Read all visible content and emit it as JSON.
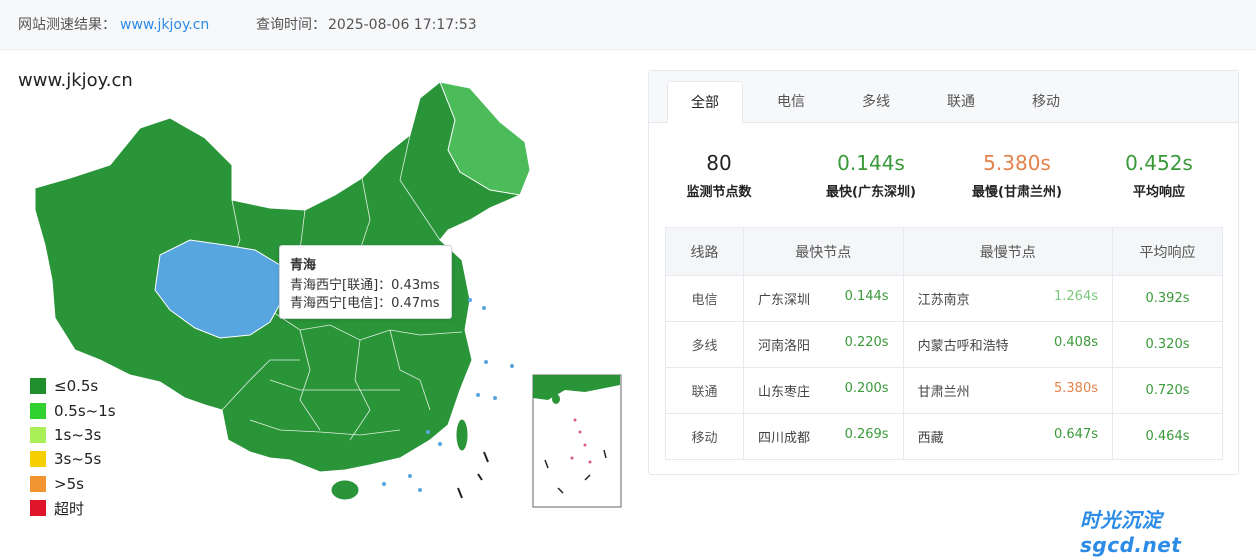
{
  "header": {
    "result_label": "网站测速结果：",
    "result_url": "www.jkjoy.cn",
    "time_label": "查询时间：",
    "time_value": "2025-08-06 17:17:53"
  },
  "site_title": "www.jkjoy.cn",
  "tooltip": {
    "title": "青海",
    "lines": [
      "青海西宁[联通]：0.43ms",
      "青海西宁[电信]：0.47ms"
    ]
  },
  "legend": [
    {
      "label": "≤0.5s",
      "color": "#1e8f2c"
    },
    {
      "label": "0.5s~1s",
      "color": "#2fd12f"
    },
    {
      "label": "1s~3s",
      "color": "#a9ef57"
    },
    {
      "label": "3s~5s",
      "color": "#f5cf00"
    },
    {
      "label": ">5s",
      "color": "#f39433"
    },
    {
      "label": "超时",
      "color": "#e0142a"
    }
  ],
  "colors": {
    "province_default": "#2a9439",
    "province_light": "#4cbb5a",
    "province_highlight": "#58a6e0",
    "green_text": "#3a9a3a",
    "light_green_text": "#7dc77d",
    "orange_text": "#e5824a"
  },
  "tabs": [
    "全部",
    "电信",
    "多线",
    "联通",
    "移动"
  ],
  "active_tab": "全部",
  "stats": [
    {
      "value": "80",
      "label": "监测节点数",
      "color": "#222"
    },
    {
      "value": "0.144s",
      "label": "最快(广东深圳)",
      "color": "#3a9a3a"
    },
    {
      "value": "5.380s",
      "label": "最慢(甘肃兰州)",
      "color": "#e5824a"
    },
    {
      "value": "0.452s",
      "label": "平均响应",
      "color": "#3a9a3a"
    }
  ],
  "table": {
    "headers": [
      "线路",
      "最快节点",
      "最慢节点",
      "平均响应"
    ],
    "rows": [
      {
        "line": "电信",
        "fast_node": "广东深圳",
        "fast_val": "0.144s",
        "slow_node": "江苏南京",
        "slow_val": "1.264s",
        "slow_color": "#7dc77d",
        "avg": "0.392s"
      },
      {
        "line": "多线",
        "fast_node": "河南洛阳",
        "fast_val": "0.220s",
        "slow_node": "内蒙古呼和浩特",
        "slow_val": "0.408s",
        "slow_color": "#3a9a3a",
        "avg": "0.320s"
      },
      {
        "line": "联通",
        "fast_node": "山东枣庄",
        "fast_val": "0.200s",
        "slow_node": "甘肃兰州",
        "slow_val": "5.380s",
        "slow_color": "#e5824a",
        "avg": "0.720s"
      },
      {
        "line": "移动",
        "fast_node": "四川成都",
        "fast_val": "0.269s",
        "slow_node": "西藏",
        "slow_val": "0.647s",
        "slow_color": "#3a9a3a",
        "avg": "0.464s"
      }
    ]
  },
  "watermark": "时光沉淀sgcd.net"
}
